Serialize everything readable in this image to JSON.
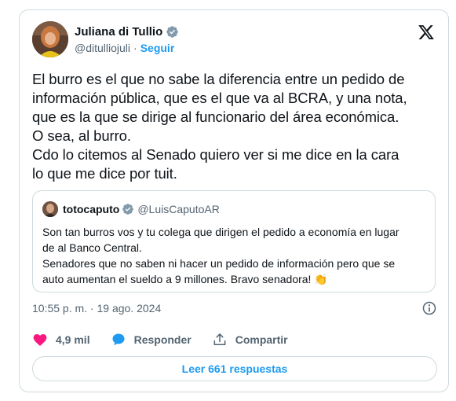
{
  "author": {
    "name": "Juliana di Tullio",
    "handle": "@ditulliojuli",
    "separator": "·",
    "follow_label": "Seguir"
  },
  "tweet": {
    "lines": [
      "El burro es el que no sabe la diferencia entre un pedido de",
      "información pública, que es el que va al BCRA, y una nota,",
      "que es la que se dirige al funcionario del área económica.",
      "O sea, al burro.",
      "Cdo lo citemos al Senado quiero ver si me dice en la cara",
      "lo que me dice por tuit."
    ]
  },
  "quote": {
    "name": "totocaputo",
    "handle": "@LuisCaputoAR",
    "lines": [
      "Son tan burros vos y tu colega que dirigen el pedido a economía en lugar",
      "de al Banco Central.",
      "Senadores que no saben ni hacer un pedido de información pero que se",
      "auto aumentan el sueldo a 9 millones. Bravo senadora! 👏"
    ]
  },
  "meta": {
    "timestamp": "10:55 p. m. · 19 ago. 2024"
  },
  "actions": {
    "likes": "4,9 mil",
    "reply_label": "Responder",
    "share_label": "Compartir"
  },
  "replies_button": "Leer 661 respuestas",
  "colors": {
    "accent": "#1d9bf0",
    "like": "#f91880",
    "muted": "#536471",
    "border": "#cfd9de",
    "text": "#0f1419"
  }
}
